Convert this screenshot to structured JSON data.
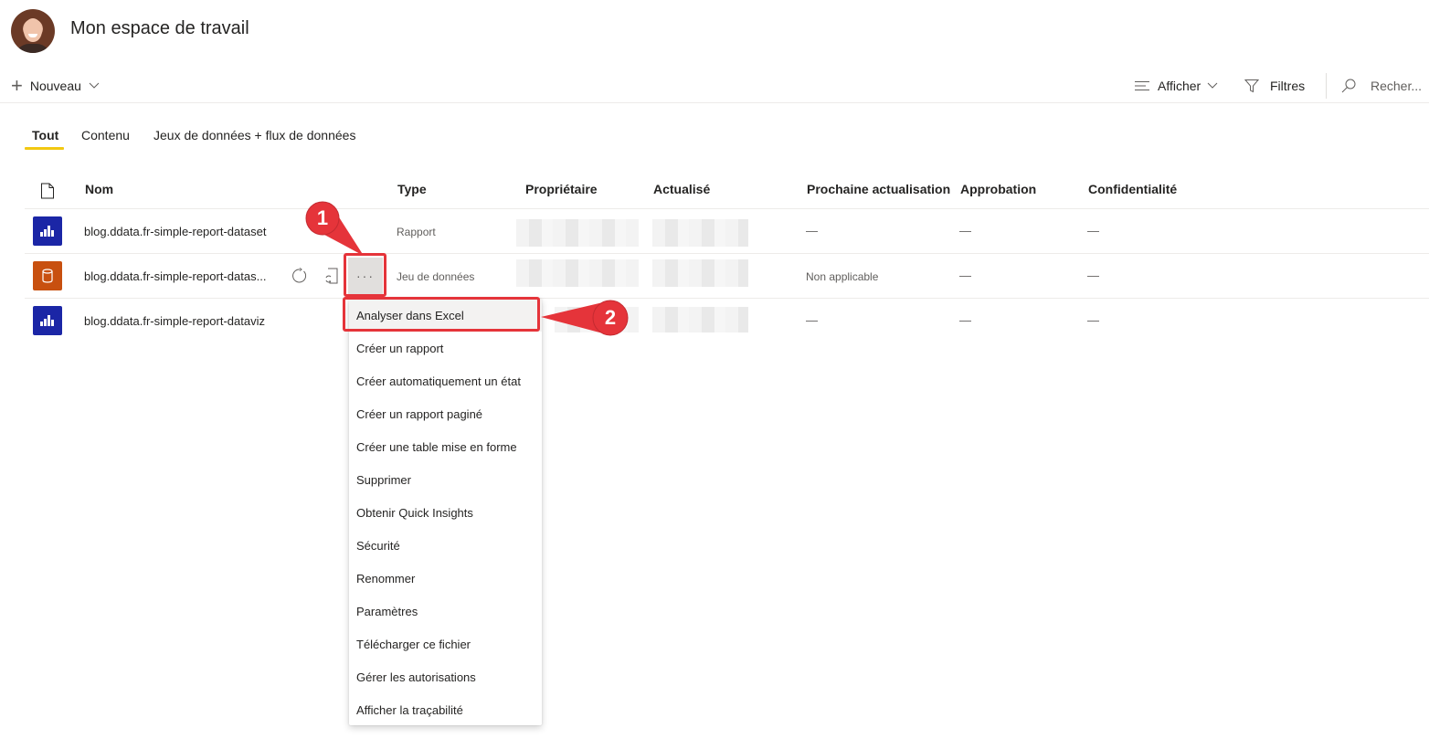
{
  "header": {
    "title": "Mon espace de travail",
    "avatar": "user-avatar"
  },
  "toolbar": {
    "new_label": "Nouveau",
    "view_label": "Afficher",
    "filters_label": "Filtres",
    "search_placeholder": "Recher..."
  },
  "tabs": [
    {
      "label": "Tout",
      "active": true
    },
    {
      "label": "Contenu",
      "active": false
    },
    {
      "label": "Jeux de données + flux de données",
      "active": false
    }
  ],
  "table": {
    "columns": [
      "Nom",
      "Type",
      "Propriétaire",
      "Actualisé",
      "Prochaine actualisation",
      "Approbation",
      "Confidentialité"
    ],
    "rows": [
      {
        "icon": "report-icon",
        "name": "blog.ddata.fr-simple-report-dataset",
        "type": "Rapport",
        "owner": "[masqué]",
        "refreshed": "[masqué]",
        "next_refresh": "—",
        "endorsement": "—",
        "sensitivity": "—"
      },
      {
        "icon": "dataset-icon",
        "name": "blog.ddata.fr-simple-report-datas...",
        "type": "Jeu de données",
        "owner": "[masqué]",
        "refreshed": "[masqué]",
        "next_refresh": "Non applicable",
        "endorsement": "—",
        "sensitivity": "—"
      },
      {
        "icon": "report-icon",
        "name": "blog.ddata.fr-simple-report-dataviz",
        "type": "",
        "owner": "[masqué]",
        "refreshed": "[masqué]",
        "next_refresh": "—",
        "endorsement": "—",
        "sensitivity": "—"
      }
    ],
    "more_label": "···"
  },
  "context_menu": {
    "items": [
      "Analyser dans Excel",
      "Créer un rapport",
      "Créer automatiquement un état",
      "Créer un rapport paginé",
      "Créer une table mise en forme",
      "Supprimer",
      "Obtenir Quick Insights",
      "Sécurité",
      "Renommer",
      "Paramètres",
      "Télécharger ce fichier",
      "Gérer les autorisations",
      "Afficher la traçabilité"
    ],
    "highlighted_index": 0
  },
  "annotations": {
    "step1": "1",
    "step2": "2",
    "color": "#e5343a"
  },
  "colors": {
    "tab_accent": "#f2c811",
    "report_icon_bg": "#1b26a6",
    "dataset_icon_bg": "#c8500f"
  }
}
